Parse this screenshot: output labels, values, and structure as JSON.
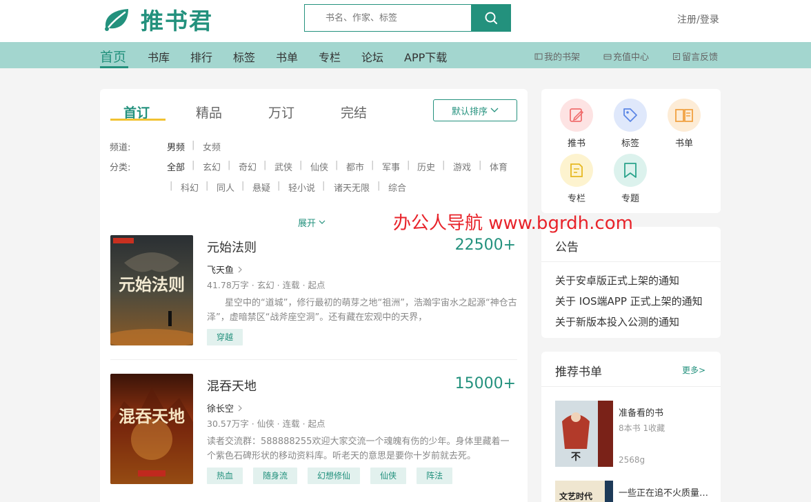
{
  "header": {
    "logo_text": "推书君",
    "search_placeholder": "书名、作家、标签",
    "login_label": "注册/登录"
  },
  "nav": {
    "items": [
      "首页",
      "书库",
      "排行",
      "标签",
      "书单",
      "专栏",
      "论坛",
      "APP下载"
    ],
    "right": [
      "我的书架",
      "充值中心",
      "留言反馈"
    ]
  },
  "main": {
    "tabs": [
      "首订",
      "精品",
      "万订",
      "完结"
    ],
    "sort_label": "默认排序",
    "channel_label": "频道:",
    "channels": [
      "男频",
      "女频"
    ],
    "category_label": "分类:",
    "categories": [
      "全部",
      "玄幻",
      "奇幻",
      "武侠",
      "仙侠",
      "都市",
      "军事",
      "历史",
      "游戏",
      "体育",
      "科幻",
      "同人",
      "悬疑",
      "轻小说",
      "诸天无限",
      "综合"
    ],
    "expand_label": "展开",
    "books": [
      {
        "title": "元始法则",
        "count": "22500+",
        "author": "飞天鱼",
        "meta": "41.78万字 · 玄幻 · 连载 · 起点",
        "desc": "星空中的“道城”，修行最初的萌芽之地“祖洲”，浩瀚宇宙水之起源“神仓古泽”，虚暗禁区“战斧座空洞”。还有藏在宏观中的天界，",
        "tags": [
          "穿越"
        ],
        "cover_text": "元始法则"
      },
      {
        "title": "混吞天地",
        "count": "15000+",
        "author": "徐长空",
        "meta": "30.57万字 · 仙侠 · 连载 · 起点",
        "desc": "读者交流群：588888255欢迎大家交流一个魂魄有伤的少年。身体里藏着一个紫色石碑形状的移动资料库。听老天的意思是要你十岁前就去死。",
        "tags": [
          "热血",
          "随身流",
          "幻想修仙",
          "仙侠",
          "阵法"
        ],
        "cover_text": "混吞天地"
      }
    ]
  },
  "quick_links": [
    {
      "label": "推书",
      "icon": "edit-icon",
      "bg": "#fde3e3",
      "fg": "#f06f6f"
    },
    {
      "label": "标签",
      "icon": "tag-icon",
      "bg": "#dfe8fb",
      "fg": "#5b86e5"
    },
    {
      "label": "书单",
      "icon": "book-icon",
      "bg": "#fdecd6",
      "fg": "#f0a040"
    },
    {
      "label": "专栏",
      "icon": "column-icon",
      "bg": "#fdf3cf",
      "fg": "#e6b821"
    },
    {
      "label": "专题",
      "icon": "bookmark-icon",
      "bg": "#dcf2ed",
      "fg": "#2aa38b"
    }
  ],
  "notices": {
    "title": "公告",
    "items": [
      "关于安卓版正式上架的通知",
      "关于 IOS端APP 正式上架的通知",
      "关于新版本投入公测的通知"
    ]
  },
  "booklists": {
    "title": "推荐书单",
    "more_label": "更多>",
    "items": [
      {
        "title": "准备看的书",
        "stats": "8本书 1收藏",
        "author": "2568g"
      },
      {
        "title": "一些正在追不火质量好的书",
        "stats": "",
        "author": ""
      }
    ]
  },
  "watermark": "办公人导航 www.bgrdh.com",
  "colors": {
    "accent": "#23917d",
    "nav_bg": "#a3d6cf"
  }
}
